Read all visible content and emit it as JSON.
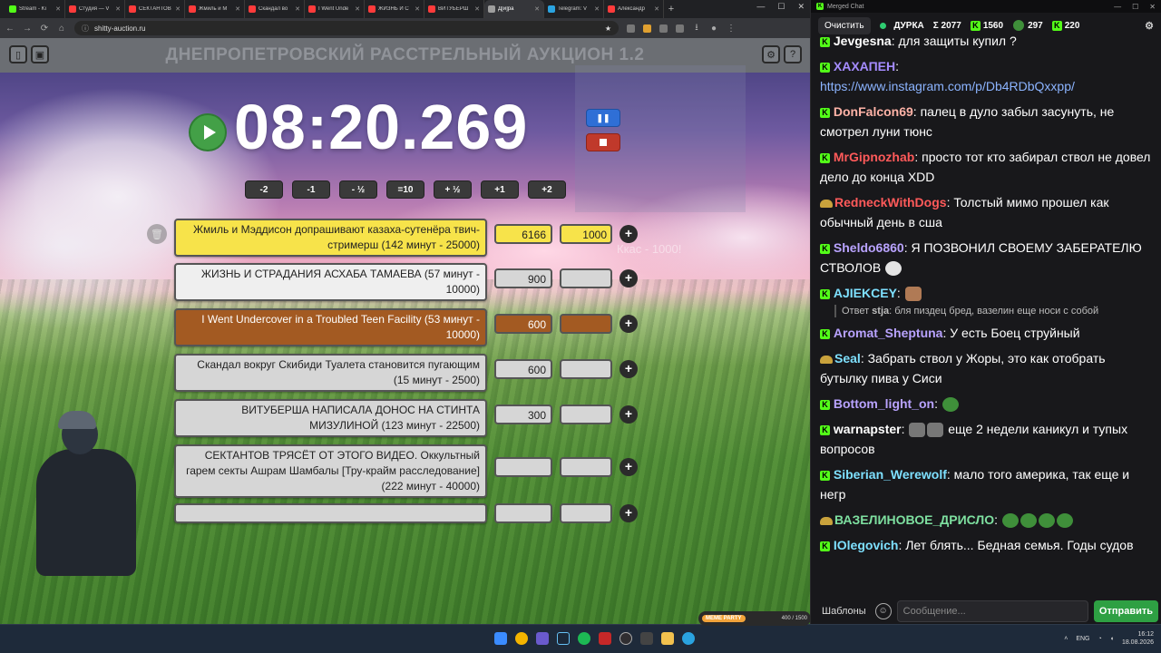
{
  "browser": {
    "tabs": [
      {
        "label": "Stream - Ki",
        "color": "#53fc18",
        "active": false
      },
      {
        "label": "Студия — V",
        "color": "#ff3b3b",
        "active": false
      },
      {
        "label": "СЕКТАНТОВ",
        "color": "#ff3b3b",
        "active": false
      },
      {
        "label": "Жмиль и М",
        "color": "#ff3b3b",
        "active": false
      },
      {
        "label": "Скандал во",
        "color": "#ff3b3b",
        "active": false
      },
      {
        "label": "I Went Unde",
        "color": "#ff3b3b",
        "active": false
      },
      {
        "label": "ЖИЗНЬ И С",
        "color": "#ff3b3b",
        "active": false
      },
      {
        "label": "ВИТУБЕРШ",
        "color": "#ff3b3b",
        "active": false
      },
      {
        "label": "Д[и]ра",
        "color": "#9e9e9e",
        "active": true
      },
      {
        "label": "Telegram: V",
        "color": "#2aa3e0",
        "active": false
      },
      {
        "label": "Александр",
        "color": "#ff3b3b",
        "active": false
      }
    ],
    "new_tab": "+",
    "url": "shitty-auction.ru"
  },
  "app": {
    "title": "ДНЕПРОПЕТРОВСКИЙ РАССТРЕЛЬНЫЙ АУКЦИОН 1.2",
    "timer": "08:20.269",
    "pause_label": "❚❚",
    "adjust_buttons": [
      "-2",
      "-1",
      "- ½",
      "=10",
      "+ ½",
      "+1",
      "+2"
    ],
    "ghost_text": "Ккас - 1000!",
    "lots": [
      {
        "name": "Жмиль и Мэддисон допрашивают казаха-сутенёра твич-стримерш (142 минут - 25000)",
        "amount": "6166",
        "input": "1000",
        "style": "yellow"
      },
      {
        "name": "ЖИЗНЬ И СТРАДАНИЯ АСХАБА ТАМАЕВА (57 минут - 10000)",
        "amount": "900",
        "input": "",
        "style": "white"
      },
      {
        "name": "I Went Undercover in a Troubled Teen Facility (53 минут - 10000)",
        "amount": "600",
        "input": "",
        "style": "brown"
      },
      {
        "name": "Скандал вокруг Скибиди Туалета становится пугающим (15 минут - 2500)",
        "amount": "600",
        "input": "",
        "style": "gray"
      },
      {
        "name": "ВИТУБЕРША НАПИСАЛА ДОНОС НА СТИНТА МИЗУЛИНОЙ (123 минут - 22500)",
        "amount": "300",
        "input": "",
        "style": "gray"
      },
      {
        "name": "СЕКТАНТОВ ТРЯСЁТ ОТ ЭТОГО ВИДЕО. Оккультный гарем секты Ашрам Шамбалы [Тру-крайм расследование] (222 минут - 40000)",
        "amount": "",
        "input": "",
        "style": "gray"
      },
      {
        "name": "",
        "amount": "",
        "input": "",
        "style": "gray"
      }
    ]
  },
  "chat": {
    "window_title": "Merged Chat",
    "clear_label": "Очистить",
    "channel": "ДУРКА",
    "total": "Σ 2077",
    "kick_count": "1560",
    "twitch_count": "297",
    "other_count": "220",
    "messages": [
      {
        "user": "Jevgesna",
        "badge": "kick",
        "color": "#ffffff",
        "text": ": для защиты купил ?"
      },
      {
        "user": "ХАХАПЕН",
        "badge": "kick",
        "color": "#a58cff",
        "text": ": ",
        "link": "https://www.instagram.com/p/Db4RDbQxxpp/"
      },
      {
        "user": "DonFalcon69",
        "badge": "kick",
        "color": "#ffb3a7",
        "text": ": палец в дуло забыл засунуть, не смотрел луни тюнс"
      },
      {
        "user": "MrGipnozhab",
        "badge": "kick",
        "color": "#ff5a5a",
        "text": ": просто тот кто забирал ствол не довел дело до конца XDD"
      },
      {
        "user": "RedneckWithDogs",
        "badge": "cowboy",
        "color": "#ff5a5a",
        "text": ": Толстый мимо прошел как обычный день в сша"
      },
      {
        "user": "Sheldo6860",
        "badge": "kick",
        "color": "#b9a3ff",
        "text": ": Я ПОЗВОНИЛ СВОЕМУ ЗАБЕРАТЕЛЮ СТВОЛОВ"
      },
      {
        "user": "AJIEKCEY",
        "badge": "kick",
        "color": "#7ee0ff",
        "text": ":",
        "reply_user": "stja",
        "reply_prefix": "Ответ ",
        "reply_text": ": бля пиздец бред, вазелин еще носи с собой"
      },
      {
        "user": "Aromat_Sheptuna",
        "badge": "kick",
        "color": "#b9a3ff",
        "text": ": У есть Боец струйный"
      },
      {
        "user": "Seal",
        "badge": "cowboy",
        "color": "#7ee0ff",
        "text": ": Забрать ствол у Жоры, это как отобрать бутылку пива у Сиси"
      },
      {
        "user": "Bottom_light_on",
        "badge": "kick",
        "color": "#b9a3ff",
        "text": ":"
      },
      {
        "user": "warnapster",
        "badge": "kick",
        "color": "#ffffff",
        "text": ": еще 2 недели каникул и тупых вопросов"
      },
      {
        "user": "Siberian_Werewolf",
        "badge": "kick",
        "color": "#7ee0ff",
        "text": ": мало того америка, так еще и негр"
      },
      {
        "user": "ВАЗЕЛИНОВОЕ_ДРИСЛО",
        "badge": "cowboy",
        "color": "#7ee0a0",
        "text": ":"
      },
      {
        "user": "IOlegovich",
        "badge": "kick",
        "color": "#7ee0ff",
        "text": ": Лет блять... Бедная семья. Годы судов"
      }
    ],
    "templates_label": "Шаблоны",
    "input_placeholder": "Сообщение...",
    "send_label": "Отправить"
  },
  "taskbar": {
    "widget_label": "MEME PARTY",
    "widget_value": "400 / 1500",
    "lang": "ENG",
    "time": "16:12",
    "date": "18.08.2026"
  }
}
